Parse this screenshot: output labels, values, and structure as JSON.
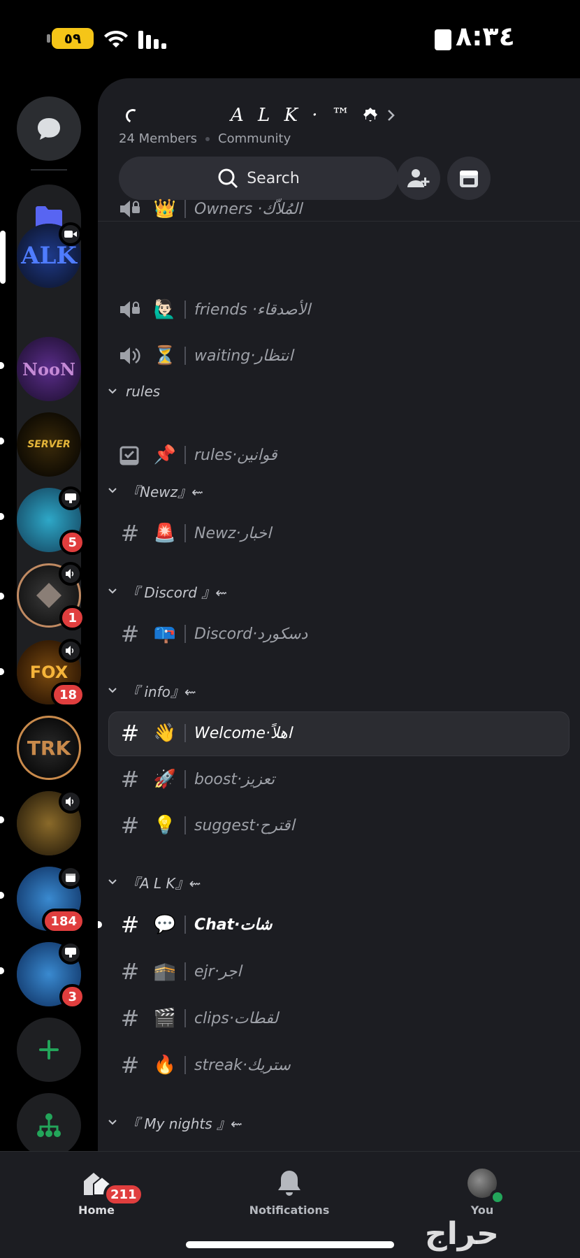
{
  "status_bar": {
    "battery": "٥٩",
    "time": "٨:٣٤"
  },
  "rail": {
    "servers": [
      {
        "label": "ALK",
        "color": "#2d4fb8"
      },
      {
        "label": "NooN",
        "color": "#6b3fa0"
      },
      {
        "label": "SERVER",
        "color": "#b8860b"
      },
      {
        "label": "",
        "badge": "5"
      },
      {
        "label": "",
        "badge": "1"
      },
      {
        "label": "FOX",
        "badge": "18"
      },
      {
        "label": "TRK",
        "color": "#c98a4b"
      },
      {
        "label": ""
      },
      {
        "label": "",
        "badge": "184"
      },
      {
        "label": "",
        "badge": "3"
      }
    ]
  },
  "server": {
    "name": "A L K · ™",
    "members": "24 Members",
    "type": "Community",
    "search_label": "Search"
  },
  "channels": {
    "voice": [
      {
        "emoji": "👑",
        "name": "Owners ·المُلاّك"
      },
      {
        "emoji": "🙋🏻‍♂️",
        "name": "friends ·الأصدقاء"
      },
      {
        "emoji": "⏳",
        "name": "waiting·انتظار"
      }
    ],
    "cat_rules": "rules",
    "rules": {
      "emoji": "📌",
      "name": "rules·قوانين"
    },
    "cat_newz": "『Newz』⇜",
    "newz": {
      "emoji": "🚨",
      "name": "Newz·اخبار"
    },
    "cat_discord": "『 Discord 』⇜",
    "discord": {
      "emoji": "📪",
      "name": "Discord·دسكورد"
    },
    "cat_info": "『 info』⇜",
    "info": [
      {
        "emoji": "👋",
        "name": "Welcome·اهلاً"
      },
      {
        "emoji": "🚀",
        "name": "boost·تعزيز"
      },
      {
        "emoji": "💡",
        "name": "suggest·اقترح"
      }
    ],
    "cat_alk": "『A L K』⇜",
    "alk": [
      {
        "emoji": "💬",
        "name": "Chat·شات"
      },
      {
        "emoji": "🕋",
        "name": "ejr·اجر"
      },
      {
        "emoji": "🎬",
        "name": "clips·لقطات"
      },
      {
        "emoji": "🔥",
        "name": "streak·ستريك"
      }
    ],
    "cat_nights": "『 My nights 』⇜"
  },
  "bottom_nav": {
    "home": "Home",
    "home_badge": "211",
    "notifications": "Notifications",
    "you": "You"
  },
  "watermark": "حراج",
  "colors": {
    "accent": "#5865f2",
    "badge": "#e03e3e",
    "online": "#23a55a",
    "green_add": "#23a55a"
  }
}
